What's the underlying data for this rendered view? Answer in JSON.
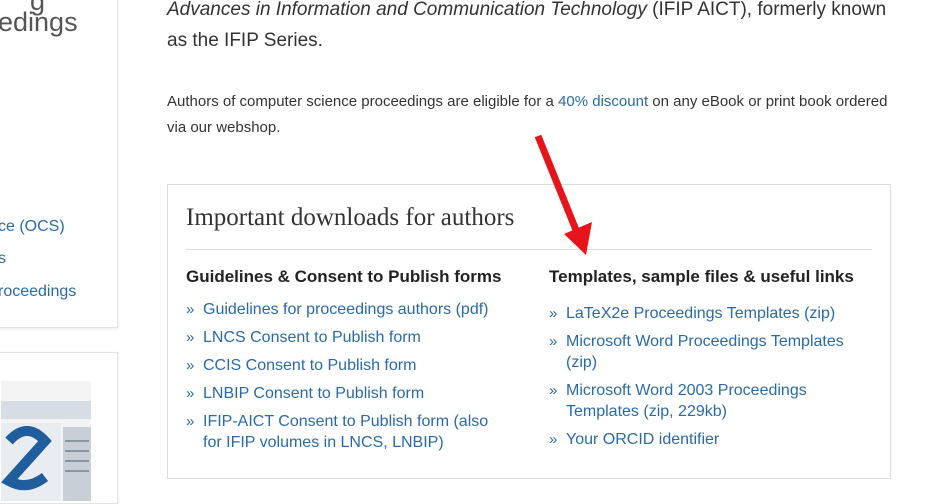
{
  "sidebar": {
    "heading_partial_top": "g",
    "heading": "edings",
    "links": [
      {
        "label": "ce (OCS)"
      },
      {
        "label": "s"
      },
      {
        "label": "roceedings"
      }
    ]
  },
  "intro": {
    "italic_text": "Advances in Information and Communication Technology",
    "suffix_text": " (IFIP AICT), formerly known as the IFIP Series."
  },
  "discount": {
    "before": "Authors of computer science proceedings are eligible for a ",
    "link_label": "40% discount",
    "after": " on any eBook or print book ordered via our webshop."
  },
  "downloads": {
    "title": "Important downloads for authors",
    "bullet": "»",
    "left_column": {
      "heading": "Guidelines & Consent to Publish forms",
      "items": [
        {
          "label": "Guidelines for proceedings authors (pdf)"
        },
        {
          "label": "LNCS Consent to Publish form"
        },
        {
          "label": "CCIS Consent to Publish form"
        },
        {
          "label": "LNBIP Consent to Publish form"
        },
        {
          "label": "IFIP-AICT Consent to Publish form (also for IFIP volumes in LNCS, LNBIP)"
        }
      ]
    },
    "right_column": {
      "heading": "Templates, sample files & useful links",
      "items": [
        {
          "label": "LaTeX2e Proceedings Templates (zip)"
        },
        {
          "label": "Microsoft Word Proceedings Templates (zip)"
        },
        {
          "label": "Microsoft Word 2003 Proceedings Templates (zip, 229kb)"
        },
        {
          "label": "Your ORCID identifier"
        }
      ]
    }
  },
  "colors": {
    "link": "#2a6aa6",
    "annotation_arrow": "#e8141b"
  },
  "icons": [
    "red-arrow-annotation",
    "newspaper-image"
  ]
}
